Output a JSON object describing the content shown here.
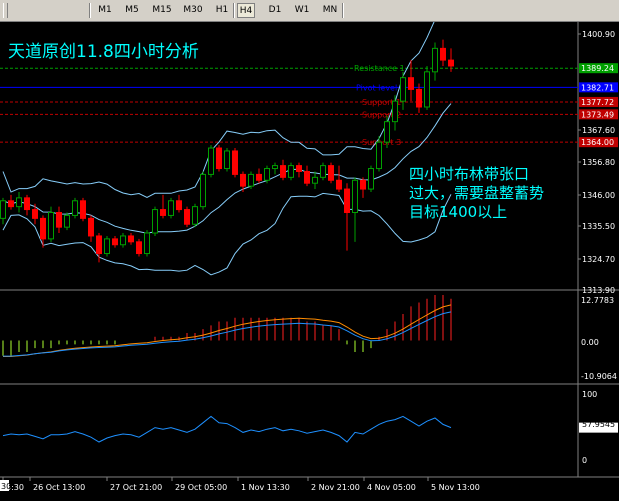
{
  "toolbar": {
    "timeframes": [
      "M1",
      "M5",
      "M15",
      "M30",
      "H1",
      "H4",
      "D1",
      "W1",
      "MN"
    ],
    "active": "H4"
  },
  "annotation": {
    "title": "天道原创11.8四小时分析",
    "note_lines": [
      "四小时布林带张口",
      "过大，需要盘整蓄势",
      "目标1400以上"
    ]
  },
  "levels": [
    {
      "name": "Resistance 1",
      "value": 1389.24,
      "color": "#00a000",
      "badge": "1389.24"
    },
    {
      "name": "Pivot level",
      "value": 1382.71,
      "color": "#0000ff",
      "badge": "1382.71"
    },
    {
      "name": "Support 1",
      "value": 1377.72,
      "color": "#c00000",
      "badge": "1377.72"
    },
    {
      "name": "Support 2",
      "value": 1373.49,
      "color": "#c00000",
      "badge": "1373.49"
    },
    {
      "name": "Support 3",
      "value": 1364.0,
      "color": "#c00000",
      "badge": "1364.00"
    }
  ],
  "price_axis": {
    "ticks": [
      "1400.90",
      "1367.60",
      "1356.80",
      "1346.00",
      "1335.50",
      "1324.70",
      "1313.90"
    ]
  },
  "macd_axis": {
    "ticks": [
      "12.7783",
      "0.00",
      "-10.9064"
    ]
  },
  "rsi_axis": {
    "ticks": [
      "100",
      "57.9545",
      "0"
    ]
  },
  "time_axis": {
    "labels": [
      "5:30",
      "26 Oct 13:00",
      "27 Oct 21:00",
      "29 Oct 05:00",
      "1 Nov 13:30",
      "2 Nov 21:00",
      "4 Nov 05:00",
      "5 Nov 13:00"
    ],
    "left_tag": "30"
  },
  "colors": {
    "bull": "#00a000",
    "bear": "#ff0000",
    "bbands": "#87cefa",
    "macd_up": "#ff2020",
    "macd_down": "#adff2f",
    "macd_signal": "#ff8c00",
    "rsi": "#1e90ff",
    "grid": "#808080"
  },
  "chart_data": {
    "type": "candlestick",
    "timeframe": "H4",
    "candles": [
      [
        1338,
        1345,
        1336,
        1344
      ],
      [
        1344,
        1346,
        1341,
        1342
      ],
      [
        1342,
        1347,
        1340,
        1345
      ],
      [
        1345,
        1346,
        1339,
        1341
      ],
      [
        1341,
        1343,
        1336,
        1338
      ],
      [
        1338,
        1339,
        1328,
        1331
      ],
      [
        1331,
        1342,
        1330,
        1340
      ],
      [
        1340,
        1342,
        1333,
        1335
      ],
      [
        1335,
        1340,
        1334,
        1339
      ],
      [
        1339,
        1345,
        1338,
        1344
      ],
      [
        1344,
        1345,
        1337,
        1338
      ],
      [
        1338,
        1339,
        1330,
        1332
      ],
      [
        1332,
        1333,
        1323,
        1326
      ],
      [
        1326,
        1332,
        1325,
        1331
      ],
      [
        1331,
        1332,
        1328,
        1329
      ],
      [
        1329,
        1333,
        1328,
        1332
      ],
      [
        1332,
        1333,
        1329,
        1330
      ],
      [
        1330,
        1331,
        1325,
        1326
      ],
      [
        1326,
        1334,
        1325,
        1333
      ],
      [
        1333,
        1342,
        1332,
        1341
      ],
      [
        1341,
        1346,
        1338,
        1339
      ],
      [
        1339,
        1345,
        1338,
        1344
      ],
      [
        1344,
        1346,
        1340,
        1341
      ],
      [
        1341,
        1342,
        1335,
        1336
      ],
      [
        1336,
        1343,
        1335,
        1342
      ],
      [
        1342,
        1354,
        1341,
        1353
      ],
      [
        1353,
        1363,
        1352,
        1362
      ],
      [
        1362,
        1363,
        1354,
        1355
      ],
      [
        1355,
        1362,
        1354,
        1361
      ],
      [
        1361,
        1362,
        1352,
        1353
      ],
      [
        1353,
        1354,
        1347,
        1349
      ],
      [
        1349,
        1354,
        1348,
        1353
      ],
      [
        1353,
        1355,
        1350,
        1351
      ],
      [
        1351,
        1356,
        1350,
        1355
      ],
      [
        1355,
        1357,
        1353,
        1356
      ],
      [
        1356,
        1358,
        1351,
        1352
      ],
      [
        1352,
        1357,
        1351,
        1356
      ],
      [
        1356,
        1357,
        1352,
        1354
      ],
      [
        1354,
        1356,
        1349,
        1350
      ],
      [
        1350,
        1354,
        1348,
        1352
      ],
      [
        1352,
        1357,
        1351,
        1356
      ],
      [
        1356,
        1357,
        1350,
        1351
      ],
      [
        1351,
        1356,
        1347,
        1348
      ],
      [
        1348,
        1350,
        1327,
        1340
      ],
      [
        1340,
        1352,
        1330,
        1351
      ],
      [
        1351,
        1352,
        1345,
        1348
      ],
      [
        1348,
        1356,
        1347,
        1355
      ],
      [
        1355,
        1366,
        1354,
        1364
      ],
      [
        1364,
        1373,
        1362,
        1371
      ],
      [
        1371,
        1380,
        1368,
        1378
      ],
      [
        1378,
        1388,
        1375,
        1386
      ],
      [
        1386,
        1392,
        1378,
        1382
      ],
      [
        1382,
        1384,
        1374,
        1376
      ],
      [
        1376,
        1390,
        1375,
        1388
      ],
      [
        1388,
        1398,
        1385,
        1396
      ],
      [
        1396,
        1399,
        1390,
        1392
      ],
      [
        1392,
        1396,
        1388,
        1390
      ]
    ],
    "price_range": [
      1313.9,
      1405
    ],
    "macd": [
      -4,
      -4,
      -3,
      -3,
      -2,
      -2,
      -2,
      -1,
      -1,
      -1,
      -1,
      -1,
      -1,
      -1,
      -1,
      0,
      0,
      0,
      0,
      1,
      1,
      1,
      1,
      2,
      2,
      3,
      4,
      5,
      5,
      6,
      6,
      6,
      6,
      6,
      6,
      6,
      6,
      6,
      5,
      5,
      4,
      4,
      3,
      -1,
      -3,
      -3,
      -2,
      1,
      3,
      5,
      7,
      9,
      10,
      11,
      12,
      12,
      11
    ],
    "macd_range": [
      -10.9064,
      12.7783
    ],
    "rsi": [
      48,
      50,
      49,
      50,
      47,
      44,
      49,
      49,
      50,
      53,
      50,
      46,
      40,
      45,
      48,
      50,
      49,
      46,
      52,
      58,
      56,
      58,
      55,
      52,
      56,
      64,
      72,
      64,
      63,
      58,
      52,
      55,
      53,
      56,
      58,
      54,
      56,
      54,
      51,
      53,
      55,
      52,
      48,
      40,
      52,
      50,
      56,
      62,
      66,
      68,
      72,
      66,
      60,
      66,
      70,
      62,
      58
    ],
    "rsi_range": [
      0,
      100
    ],
    "rsi_value": 57.9545
  }
}
